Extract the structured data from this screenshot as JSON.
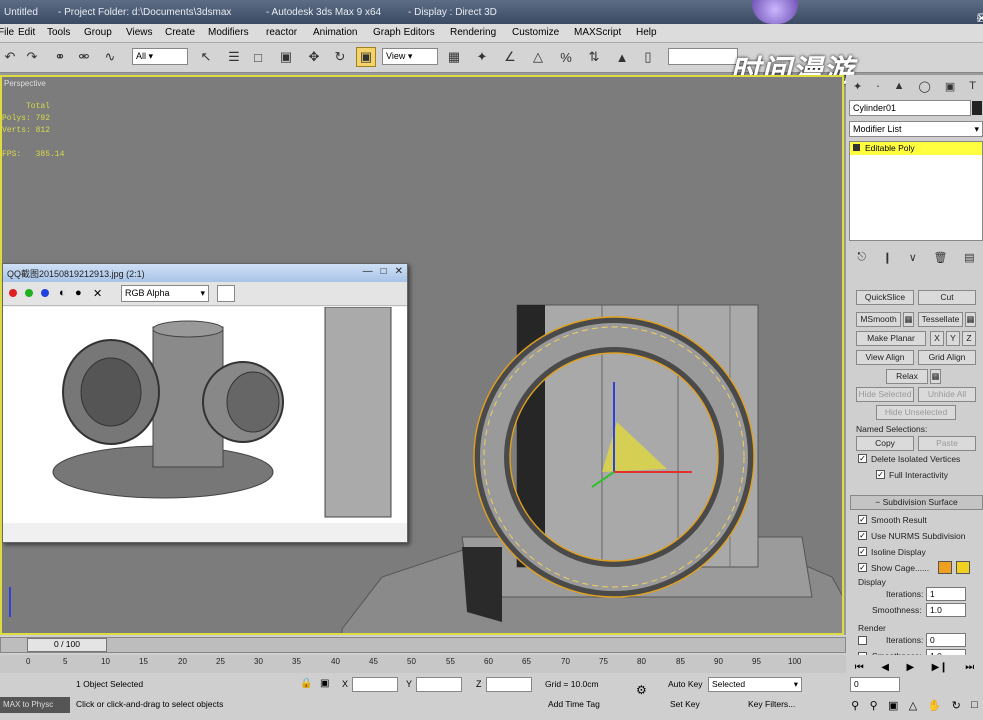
{
  "titlebar": {
    "app_icon_text": "Untitled",
    "project_folder": "- Project Folder: d:\\Documents\\3dsmax",
    "app_title": "- Autodesk 3ds Max 9 x64",
    "display": "- Display : Direct 3D"
  },
  "menu": [
    "File",
    "Edit",
    "Tools",
    "Group",
    "Views",
    "Create",
    "Modifiers",
    "reactor",
    "Animation",
    "Graph Editors",
    "Rendering",
    "Customize",
    "MAXScript",
    "Help"
  ],
  "toolbar": {
    "selection_filter": "All",
    "ref_coord": "View"
  },
  "watermark": "时间漫游",
  "viewport": {
    "label": "Perspective",
    "stats": {
      "header": "     Total",
      "polys": "Polys: 792",
      "verts": "Verts: 812",
      "fps": "FPS:   385.14"
    }
  },
  "image_window": {
    "title": "QQ截图20150819212913.jpg (2:1)",
    "channel": "RGB Alpha"
  },
  "command_panel": {
    "object_name": "Cylinder01",
    "modifier_list": "Modifier List",
    "stack_item": "Editable Poly",
    "buttons": {
      "quickslice": "QuickSlice",
      "cut": "Cut",
      "msmooth": "MSmooth",
      "tessellate": "Tessellate",
      "make_planar": "Make Planar",
      "x": "X",
      "y": "Y",
      "z": "Z",
      "view_align": "View Align",
      "grid_align": "Grid Align",
      "relax": "Relax",
      "hide_selected": "Hide Selected",
      "unhide_all": "Unhide All",
      "hide_unselected": "Hide Unselected",
      "copy": "Copy",
      "paste": "Paste"
    },
    "named_selections": "Named Selections:",
    "delete_isolated": "Delete Isolated Vertices",
    "full_interactivity": "Full Interactivity",
    "subdivision_surface": "Subdivision Surface",
    "smooth_result": "Smooth Result",
    "use_nurms": "Use NURMS Subdivision",
    "isoline_display": "Isoline Display",
    "show_cage": "Show Cage......",
    "display_label": "Display",
    "iterations_label": "Iterations:",
    "iterations_value": "1",
    "smoothness_label": "Smoothness:",
    "smoothness_value": "1.0",
    "render_label": "Render",
    "render_iterations_value": "0",
    "render_smoothness_value": "1.0"
  },
  "timeline": {
    "frame_display": "0 / 100",
    "ticks": [
      "0",
      "5",
      "10",
      "15",
      "20",
      "25",
      "30",
      "35",
      "40",
      "45",
      "50",
      "55",
      "60",
      "65",
      "70",
      "75",
      "80",
      "85",
      "90",
      "95",
      "100"
    ]
  },
  "status": {
    "max_script": "MAX to Physc",
    "objects_selected": "1 Object Selected",
    "prompt": "Click or click-and-drag to select objects",
    "x_label": "X",
    "y_label": "Y",
    "z_label": "Z",
    "grid": "Grid = 10.0cm",
    "add_time_tag": "Add Time Tag",
    "auto_key": "Auto Key",
    "selected": "Selected",
    "set_key": "Set Key",
    "key_filters": "Key Filters...",
    "frame": "0"
  },
  "colors": {
    "cage_color_1": "#f0a020",
    "cage_color_2": "#f0d020",
    "stack_highlight": "#ffff40"
  }
}
